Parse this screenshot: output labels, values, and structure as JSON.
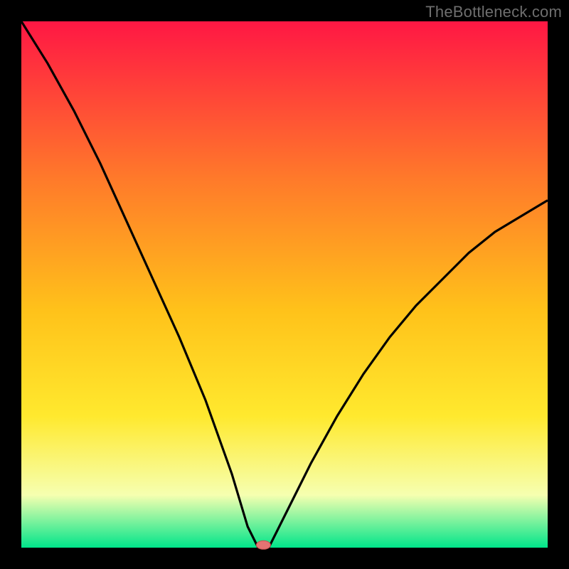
{
  "watermark": "TheBottleneck.com",
  "colors": {
    "bg": "#000000",
    "grad_top": "#ff1744",
    "grad_mid1": "#ff7a2a",
    "grad_mid2": "#ffc21a",
    "grad_mid3": "#ffe92e",
    "grad_mid4": "#f6ffb0",
    "grad_bottom": "#00e58a",
    "curve": "#000000",
    "marker_fill": "#e57373",
    "marker_stroke": "#c85050"
  },
  "chart_data": {
    "type": "line",
    "title": "",
    "xlabel": "",
    "ylabel": "",
    "xlim": [
      0,
      100
    ],
    "ylim": [
      0,
      100
    ],
    "series": [
      {
        "name": "bottleneck-curve",
        "x": [
          0,
          5,
          10,
          15,
          20,
          25,
          30,
          35,
          40,
          43,
          45,
          47,
          50,
          55,
          60,
          65,
          70,
          75,
          80,
          85,
          90,
          95,
          100
        ],
        "values": [
          100,
          92,
          83,
          73,
          62,
          51,
          40,
          28,
          14,
          4,
          0,
          0,
          6,
          16,
          25,
          33,
          40,
          46,
          51,
          56,
          60,
          63,
          66
        ]
      }
    ],
    "marker": {
      "name": "optimal-point",
      "x": 46,
      "y": 0.5
    }
  }
}
